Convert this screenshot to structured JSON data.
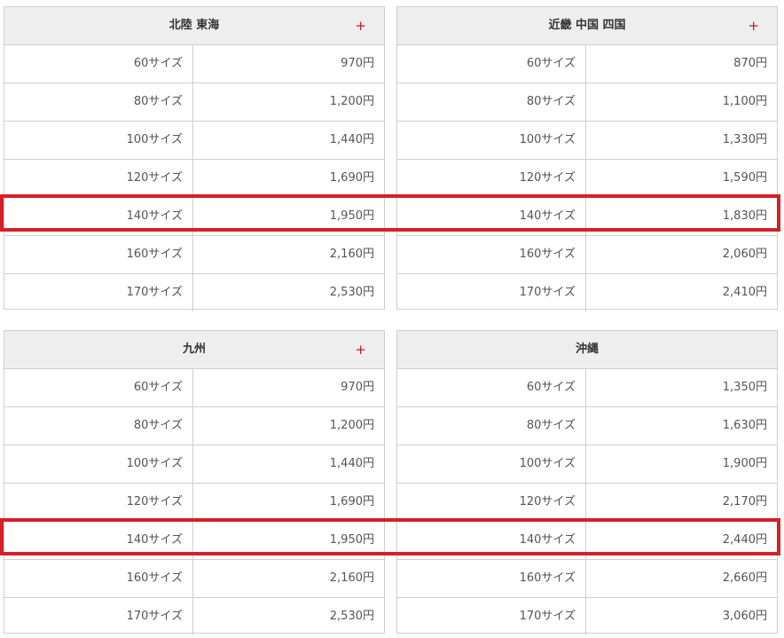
{
  "tables": [
    {
      "title": "北陸 東海",
      "plus": "+",
      "rows": [
        {
          "size": "60サイズ",
          "price": "970円"
        },
        {
          "size": "80サイズ",
          "price": "1,200円"
        },
        {
          "size": "100サイズ",
          "price": "1,440円"
        },
        {
          "size": "120サイズ",
          "price": "1,690円"
        },
        {
          "size": "140サイズ",
          "price": "1,950円"
        },
        {
          "size": "160サイズ",
          "price": "2,160円"
        },
        {
          "size": "170サイズ",
          "price": "2,530円"
        }
      ]
    },
    {
      "title": "近畿 中国 四国",
      "plus": "+",
      "rows": [
        {
          "size": "60サイズ",
          "price": "870円"
        },
        {
          "size": "80サイズ",
          "price": "1,100円"
        },
        {
          "size": "100サイズ",
          "price": "1,330円"
        },
        {
          "size": "120サイズ",
          "price": "1,590円"
        },
        {
          "size": "140サイズ",
          "price": "1,830円"
        },
        {
          "size": "160サイズ",
          "price": "2,060円"
        },
        {
          "size": "170サイズ",
          "price": "2,410円"
        }
      ]
    },
    {
      "title": "九州",
      "plus": "+",
      "rows": [
        {
          "size": "60サイズ",
          "price": "970円"
        },
        {
          "size": "80サイズ",
          "price": "1,200円"
        },
        {
          "size": "100サイズ",
          "price": "1,440円"
        },
        {
          "size": "120サイズ",
          "price": "1,690円"
        },
        {
          "size": "140サイズ",
          "price": "1,950円"
        },
        {
          "size": "160サイズ",
          "price": "2,160円"
        },
        {
          "size": "170サイズ",
          "price": "2,530円"
        }
      ]
    },
    {
      "title": "沖縄",
      "plus": "",
      "rows": [
        {
          "size": "60サイズ",
          "price": "1,350円"
        },
        {
          "size": "80サイズ",
          "price": "1,630円"
        },
        {
          "size": "100サイズ",
          "price": "1,900円"
        },
        {
          "size": "120サイズ",
          "price": "2,170円"
        },
        {
          "size": "140サイズ",
          "price": "2,440円"
        },
        {
          "size": "160サイズ",
          "price": "2,660円"
        },
        {
          "size": "170サイズ",
          "price": "3,060円"
        }
      ]
    }
  ],
  "colors": {
    "header_bg": "#eeeeee",
    "border": "#cfcfcf",
    "plus": "#c8161d",
    "highlight": "#d71f26"
  }
}
